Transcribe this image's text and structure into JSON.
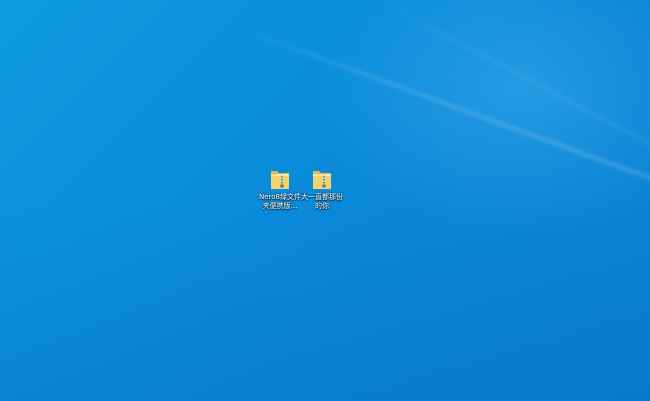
{
  "desktop": {
    "icons": [
      {
        "label": "Nero8绿文件夹便携版...",
        "icon": "zip-folder-icon"
      },
      {
        "label": "大一直都那份的你",
        "icon": "zip-folder-icon"
      }
    ]
  },
  "colors": {
    "wallpaper_base": "#0a8fdc",
    "label_text": "#ffffff",
    "folder_yellow": "#f5d36b"
  }
}
